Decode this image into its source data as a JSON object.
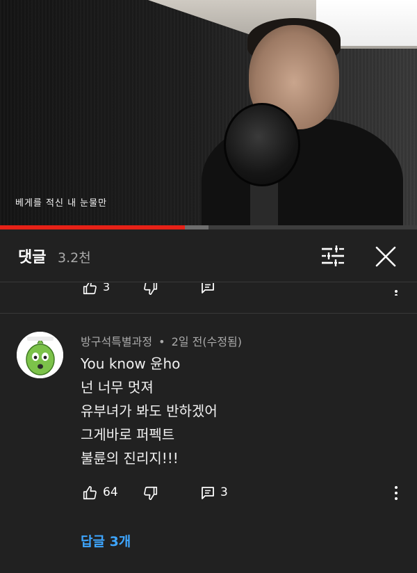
{
  "video": {
    "caption": "베게를 적신 내 눈물만",
    "progress_played_fraction": 0.443,
    "progress_buffered_fraction": 0.5
  },
  "comments_header": {
    "title": "댓글",
    "count": "3.2천",
    "sort_icon": "sort-filter-icon",
    "close_icon": "close-icon"
  },
  "previous_comment": {
    "like_count": "3"
  },
  "comment": {
    "author": "방구석특별과정",
    "separator": "•",
    "time": "2일 전(수정됨)",
    "lines": [
      "You know 윤ho",
      "넌 너무 멋져",
      "유부녀가 봐도 반하겠어",
      "그게바로 퍼펙트",
      "불륜의 진리지!!!"
    ],
    "like_count": "64",
    "reply_count": "3",
    "replies_link": "답글 3개"
  },
  "colors": {
    "background": "#212121",
    "progress_played": "#e62117",
    "link": "#3ea6ff",
    "secondary_text": "#aaaaaa"
  }
}
